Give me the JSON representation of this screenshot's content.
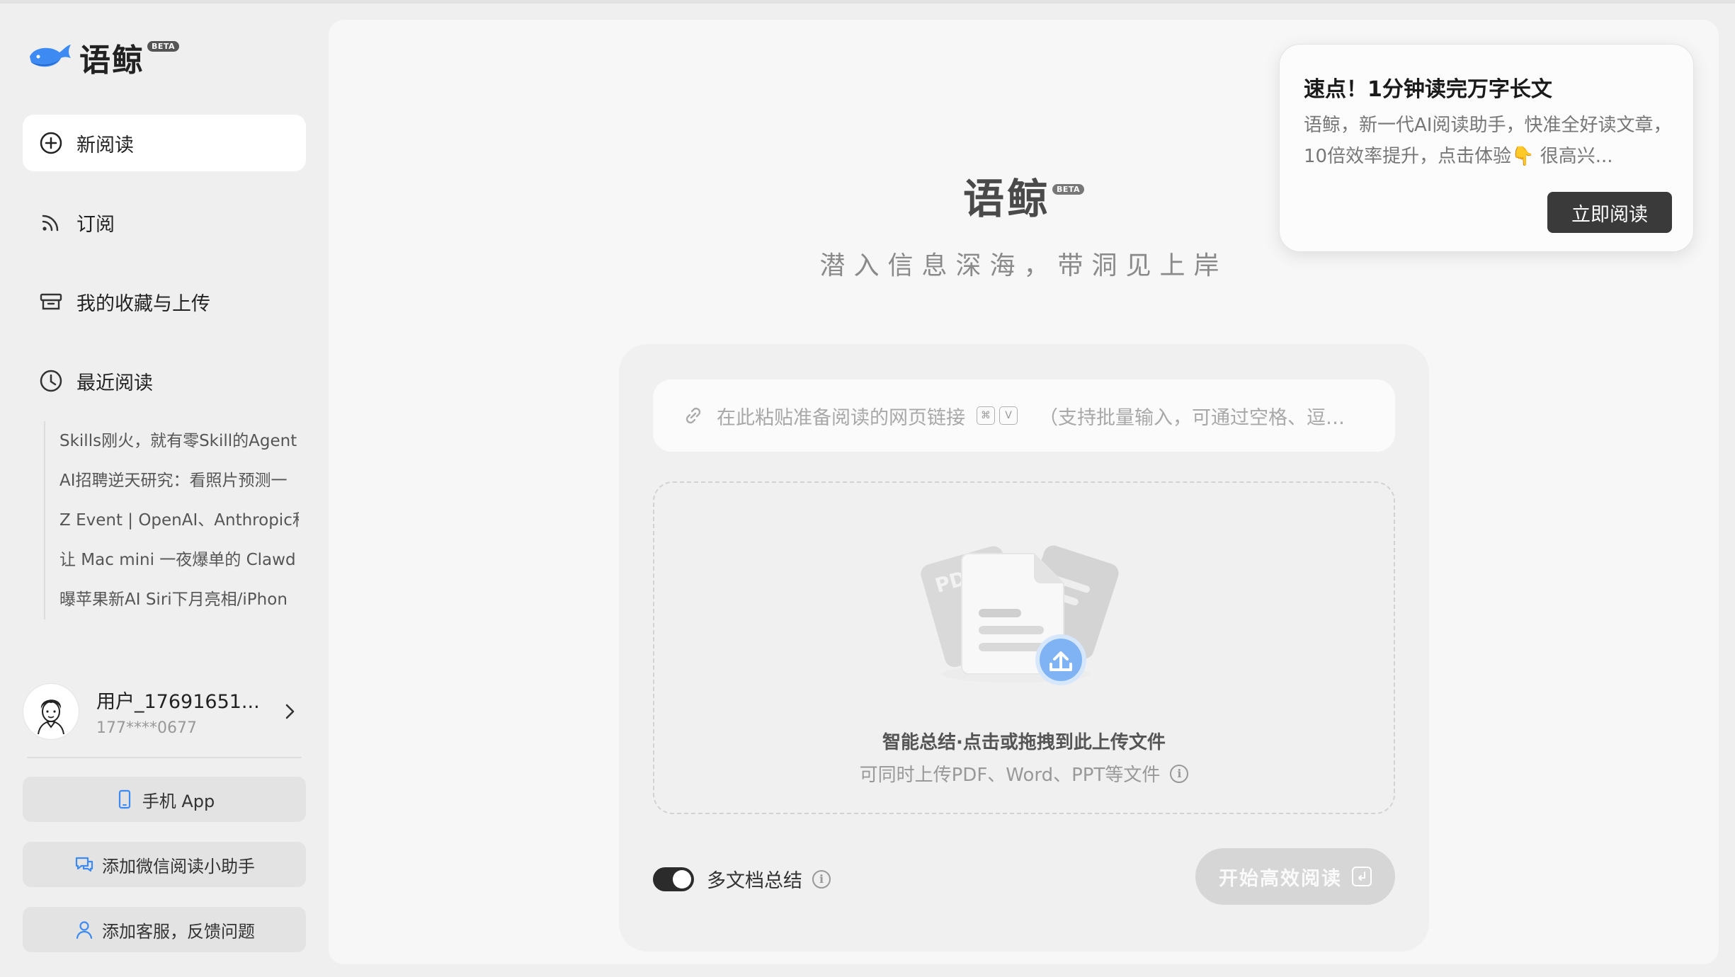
{
  "brand": {
    "name": "语鲸",
    "badge": "BETA"
  },
  "sidebar": {
    "nav": [
      {
        "label": "新阅读",
        "icon": "plus-circle-icon"
      },
      {
        "label": "订阅",
        "icon": "rss-icon"
      },
      {
        "label": "我的收藏与上传",
        "icon": "archive-box-icon"
      },
      {
        "label": "最近阅读",
        "icon": "clock-icon"
      }
    ],
    "recent": [
      "Skills刚火，就有零Skill的Agent",
      "AI招聘逆天研究：看照片预测一",
      "Z Event | OpenAI、Anthropic和",
      "让 Mac mini 一夜爆单的 Clawd",
      "曝苹果新AI Siri下月亮相/iPhon"
    ],
    "user": {
      "name": "用户_17691651...",
      "phone": "177****0677"
    },
    "buttons": [
      {
        "label": "手机 App",
        "icon": "phone-icon"
      },
      {
        "label": "添加微信阅读小助手",
        "icon": "chat-bubbles-icon"
      },
      {
        "label": "添加客服，反馈问题",
        "icon": "person-icon"
      }
    ]
  },
  "main": {
    "title": "语鲸",
    "badge": "BETA",
    "subtitle": "潜入信息深海，带洞见上岸",
    "link_input": {
      "placeholder": "在此粘贴准备阅读的网页链接",
      "shortcut_keys": [
        "⌘",
        "V"
      ],
      "hint": "（支持批量输入，可通过空格、逗号分隔多个链接）"
    },
    "dropzone": {
      "title": "智能总结·点击或拖拽到此上传文件",
      "subtitle": "可同时上传PDF、Word、PPT等文件",
      "illustration_label": "PDF"
    },
    "multi_doc": {
      "label": "多文档总结",
      "enabled": true
    },
    "start_button": {
      "label": "开始高效阅读"
    }
  },
  "popup": {
    "title": "速点！1分钟读完万字长文",
    "body": "语鲸，新一代AI阅读助手，快准全好读文章，10倍效率提升，点击体验👇 很高兴...",
    "button": "立即阅读"
  },
  "colors": {
    "accent_blue": "#3d8bf2",
    "dark_button": "#3a3a3a",
    "toggle_on": "#2b2b2b"
  }
}
